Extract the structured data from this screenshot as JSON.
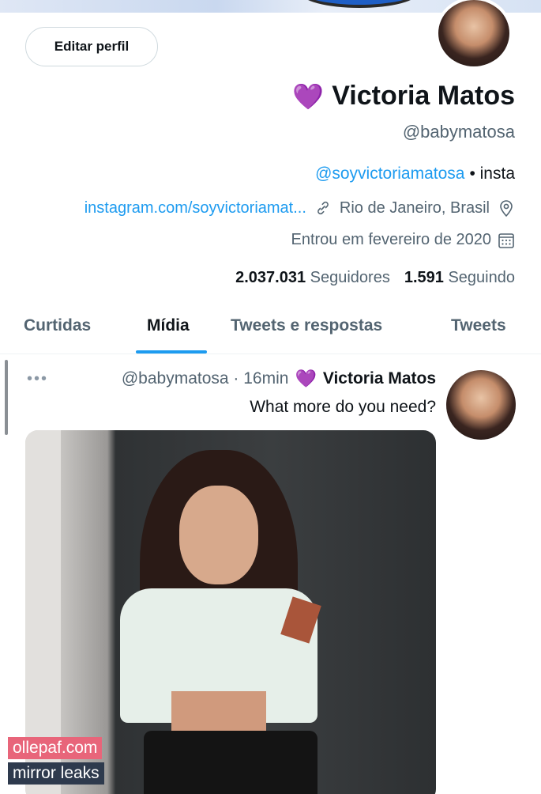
{
  "profile": {
    "edit_button": "Editar perfil",
    "name": "Victoria Matos",
    "verified_emoji": "💜",
    "handle": "@babymatosa",
    "bio_prefix": "• insta",
    "bio_link": "@soyvictoriamatosa",
    "location": "Rio de Janeiro, Brasil",
    "website": "instagram.com/soyvictoriamat...",
    "joined": "Entrou em fevereiro de 2020",
    "following_count": "1.591",
    "following_label": "Seguindo",
    "followers_count": "2.037.031",
    "followers_label": "Seguidores"
  },
  "icons": {
    "location": "location-pin-icon",
    "link": "link-icon",
    "calendar": "calendar-icon",
    "more": "more-options-icon"
  },
  "tabs": [
    {
      "label": "Tweets"
    },
    {
      "label": "Tweets e respostas"
    },
    {
      "label": "Mídia"
    },
    {
      "label": "Curtidas"
    }
  ],
  "tweet": {
    "name": "Victoria Matos",
    "emoji": "💜",
    "handle_time": "@babymatosa · 16min",
    "more": "•••",
    "text": "What more do you need?"
  },
  "watermark": {
    "line1": "ollepaf.com",
    "line2": "mirror leaks"
  },
  "colors": {
    "accent": "#1d9bf0",
    "heart": "#8b3fd9",
    "secondary_text": "#536471"
  }
}
